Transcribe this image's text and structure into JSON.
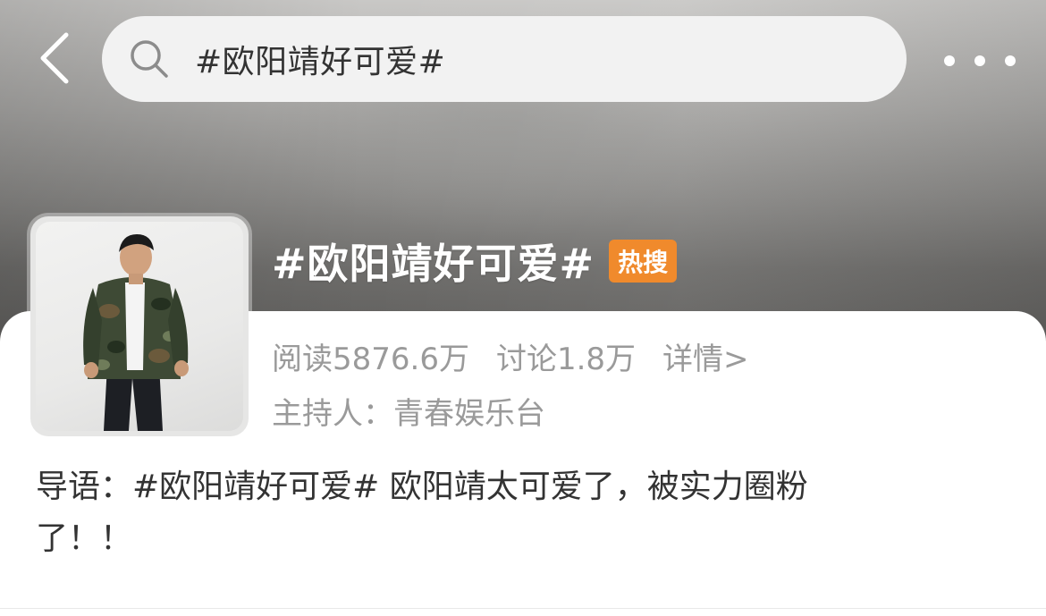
{
  "nav": {
    "search_text": "#欧阳靖好可爱#"
  },
  "topic": {
    "title": "#欧阳靖好可爱#",
    "badge": "热搜",
    "reads": "阅读5876.6万",
    "discussions": "讨论1.8万",
    "details_link": "详情>",
    "host": "主持人：青春娱乐台"
  },
  "intro": {
    "line1": "导语：#欧阳靖好可爱# 欧阳靖太可爱了，被实力圈粉",
    "line2": "了！！"
  },
  "colors": {
    "badge": "#f08a2c",
    "meta_text": "#9a9a9a",
    "body_text": "#333333"
  }
}
